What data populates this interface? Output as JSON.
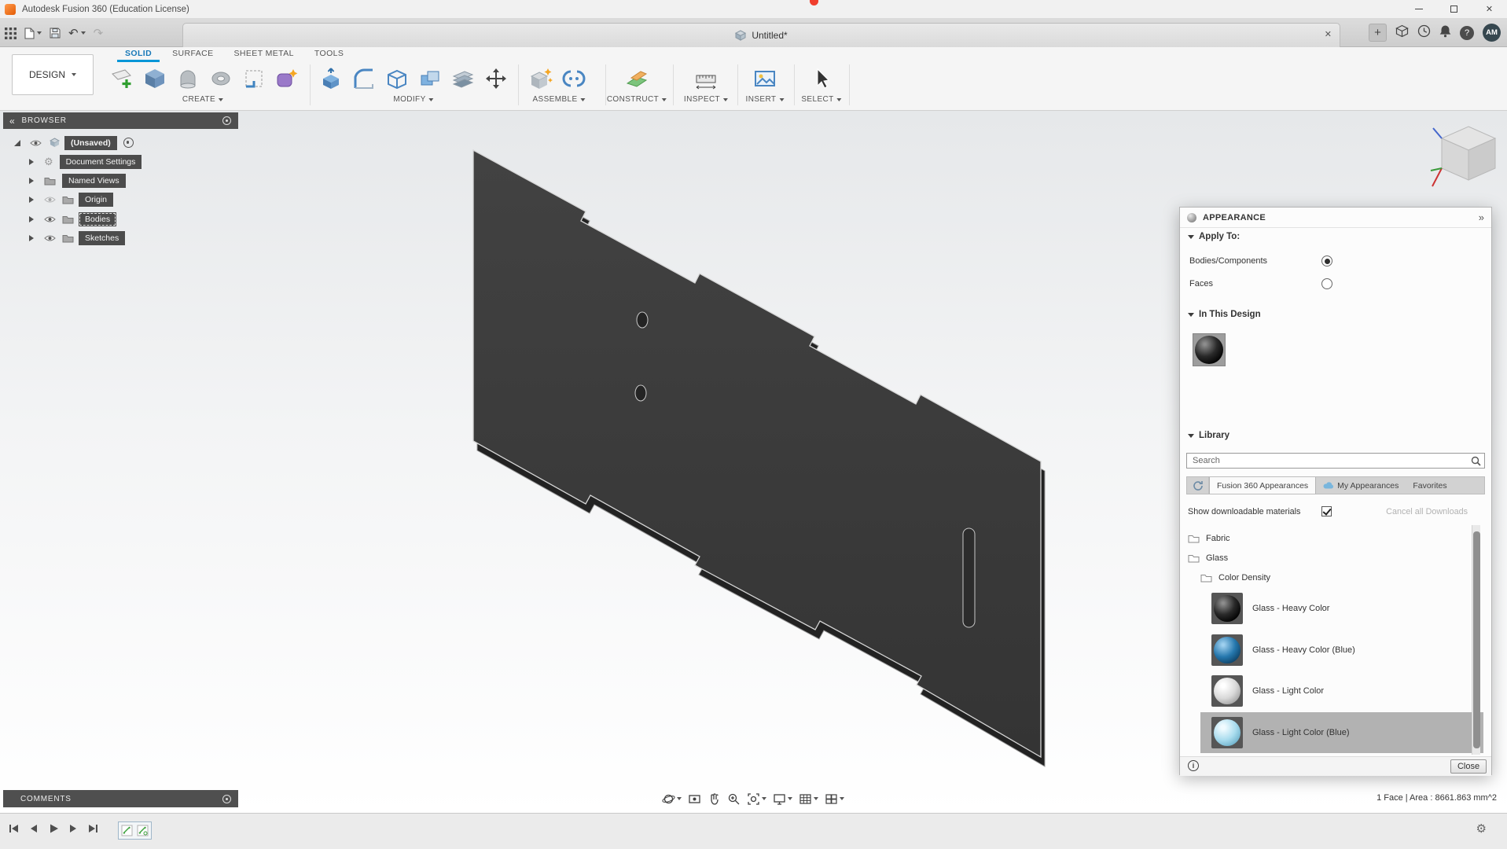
{
  "window": {
    "title": "Autodesk Fusion 360 (Education License)"
  },
  "tabbar": {
    "doc_title": "Untitled*",
    "avatar_initials": "AM"
  },
  "ribbon": {
    "workspace": "DESIGN",
    "tabs": [
      {
        "label": "SOLID",
        "active": true
      },
      {
        "label": "SURFACE",
        "active": false
      },
      {
        "label": "SHEET METAL",
        "active": false
      },
      {
        "label": "TOOLS",
        "active": false
      }
    ],
    "groups": [
      {
        "label": "CREATE"
      },
      {
        "label": "MODIFY"
      },
      {
        "label": "ASSEMBLE"
      },
      {
        "label": "CONSTRUCT"
      },
      {
        "label": "INSPECT"
      },
      {
        "label": "INSERT"
      },
      {
        "label": "SELECT"
      }
    ]
  },
  "browser": {
    "header": "BROWSER",
    "root_label": "(Unsaved)",
    "items": [
      {
        "label": "Document Settings"
      },
      {
        "label": "Named Views"
      },
      {
        "label": "Origin"
      },
      {
        "label": "Bodies"
      },
      {
        "label": "Sketches"
      }
    ]
  },
  "appearance": {
    "title": "APPEARANCE",
    "apply_to_label": "Apply To:",
    "apply_options": [
      {
        "label": "Bodies/Components",
        "selected": true
      },
      {
        "label": "Faces",
        "selected": false
      }
    ],
    "in_this_design_label": "In This Design",
    "in_this_design_swatch_color": "#1a1a1a",
    "library_label": "Library",
    "search_placeholder": "Search",
    "tabs": [
      {
        "label": "Fusion 360 Appearances",
        "active": true
      },
      {
        "label": "My Appearances",
        "active": false
      },
      {
        "label": "Favorites",
        "active": false
      }
    ],
    "show_downloadable_label": "Show downloadable materials",
    "show_downloadable_checked": true,
    "cancel_downloads_label": "Cancel all Downloads",
    "folders": [
      {
        "label": "Fabric"
      },
      {
        "label": "Glass"
      },
      {
        "label": "Color Density"
      }
    ],
    "materials": [
      {
        "name": "Glass - Heavy Color",
        "swatch_color": "#121212",
        "selected": false
      },
      {
        "name": "Glass - Heavy Color (Blue)",
        "swatch_color": "#1d6da6",
        "selected": false
      },
      {
        "name": "Glass - Light Color",
        "swatch_color": "#d8d8d8",
        "selected": false
      },
      {
        "name": "Glass - Light Color (Blue)",
        "swatch_color": "#a8dcee",
        "selected": true
      }
    ],
    "close_label": "Close"
  },
  "statusbar": {
    "comments_label": "COMMENTS",
    "selection_info": "1 Face | Area : 8661.863 mm^2"
  },
  "icons": {
    "close": "✕",
    "tab_close": "✕",
    "new_tab": "+",
    "undo": "↶",
    "redo": "↷",
    "collapse_left": "«",
    "collapse_right": "»",
    "help": "?",
    "gear": "⚙",
    "info": "i"
  }
}
